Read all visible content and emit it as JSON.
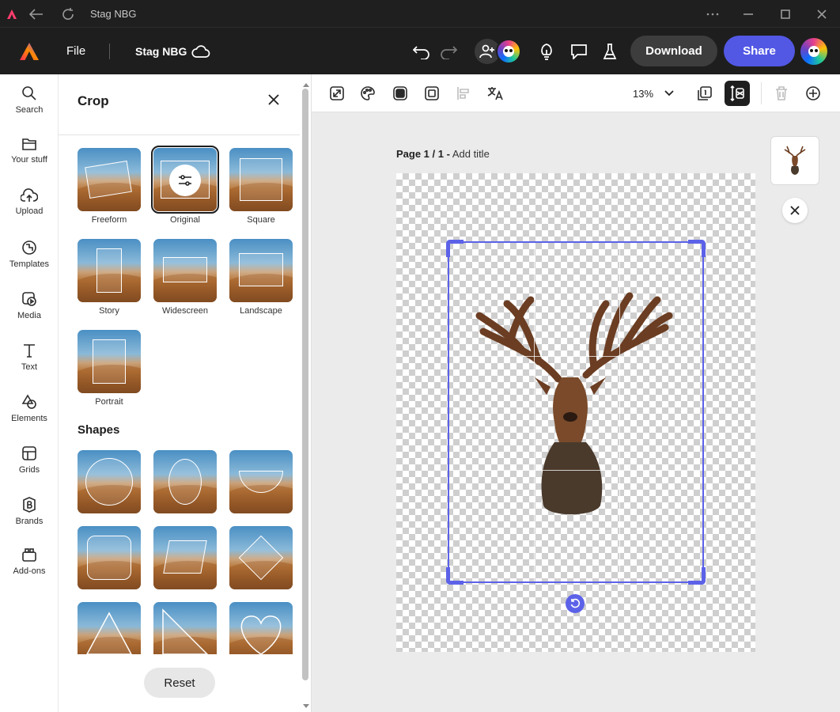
{
  "window": {
    "title": "Stag NBG"
  },
  "header": {
    "file_label": "File",
    "doc_title": "Stag NBG",
    "download_label": "Download",
    "share_label": "Share",
    "icons": [
      "adobe-express-logo",
      "cloud-icon",
      "undo-icon",
      "redo-icon",
      "invite-icon",
      "bulb-icon",
      "comment-icon",
      "flask-icon"
    ]
  },
  "rail": {
    "items": [
      {
        "label": "Search",
        "icon": "search-icon"
      },
      {
        "label": "Your stuff",
        "icon": "folder-icon"
      },
      {
        "label": "Upload",
        "icon": "upload-icon"
      },
      {
        "label": "Templates",
        "icon": "templates-icon"
      },
      {
        "label": "Media",
        "icon": "media-icon"
      },
      {
        "label": "Text",
        "icon": "text-icon"
      },
      {
        "label": "Elements",
        "icon": "elements-icon"
      },
      {
        "label": "Grids",
        "icon": "grids-icon"
      },
      {
        "label": "Brands",
        "icon": "brands-icon"
      },
      {
        "label": "Add-ons",
        "icon": "addons-icon"
      }
    ]
  },
  "crop_panel": {
    "title": "Crop",
    "aspect_options": [
      "Freeform",
      "Original",
      "Square",
      "Story",
      "Widescreen",
      "Landscape",
      "Portrait"
    ],
    "selected": "Original",
    "shapes_heading": "Shapes",
    "shapes": [
      "circle",
      "ellipse",
      "half-circle",
      "rounded-square",
      "parallelogram",
      "diamond",
      "triangle",
      "right-triangle",
      "heart"
    ],
    "reset_label": "Reset"
  },
  "toolbar": {
    "zoom": "13%",
    "tools": [
      "resize-icon",
      "color-palette-icon",
      "shape-icon",
      "frame-icon",
      "align-icon",
      "translate-icon",
      "pages-icon",
      "crop-adjust-icon",
      "trash-icon",
      "add-icon"
    ]
  },
  "canvas": {
    "page_prefix": "Page 1 / 1 -",
    "add_title": "Add title"
  }
}
